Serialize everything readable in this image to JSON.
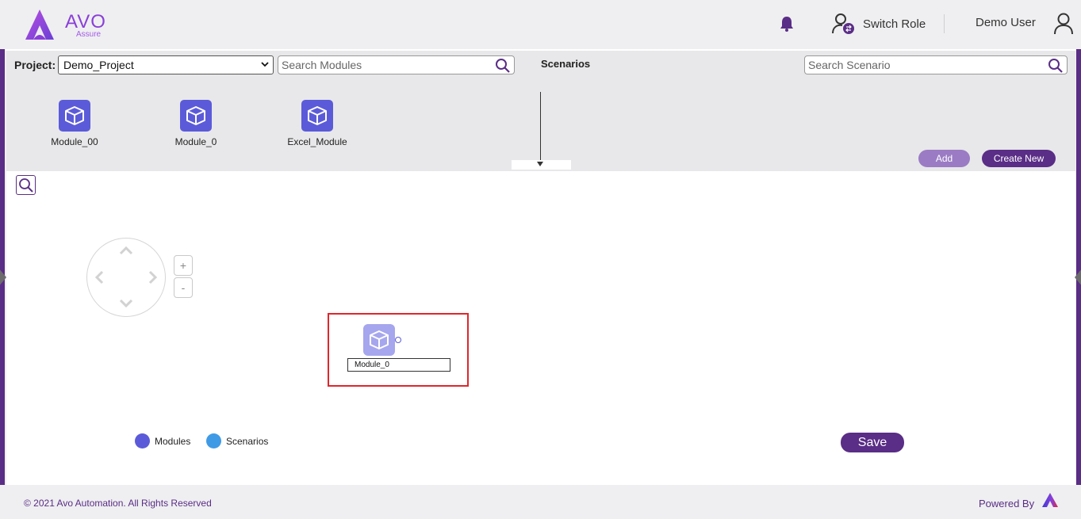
{
  "header": {
    "logo_text": "AVO",
    "logo_sub": "Assure",
    "switch_role": "Switch Role",
    "user_name": "Demo User"
  },
  "toolbar": {
    "project_label": "Project:",
    "project_value": "Demo_Project",
    "search_modules_placeholder": "Search Modules",
    "scenarios_title": "Scenarios",
    "search_scenario_placeholder": "Search Scenario",
    "add_label": "Add",
    "create_new_label": "Create New"
  },
  "modules": [
    {
      "label": "Module_00"
    },
    {
      "label": "Module_0"
    },
    {
      "label": "Excel_Module"
    }
  ],
  "canvas": {
    "zoom_in": "+",
    "zoom_out": "-",
    "node_name": "Module_0"
  },
  "legend": {
    "modules": "Modules",
    "scenarios": "Scenarios",
    "modules_color": "#5b5bd9",
    "scenarios_color": "#3f9ae6"
  },
  "actions": {
    "save_label": "Save"
  },
  "footer": {
    "copyright": "© 2021 Avo Automation. All Rights Reserved",
    "powered_by": "Powered By"
  },
  "colors": {
    "brand": "#5a2d86",
    "accent": "#8a3fd9"
  }
}
